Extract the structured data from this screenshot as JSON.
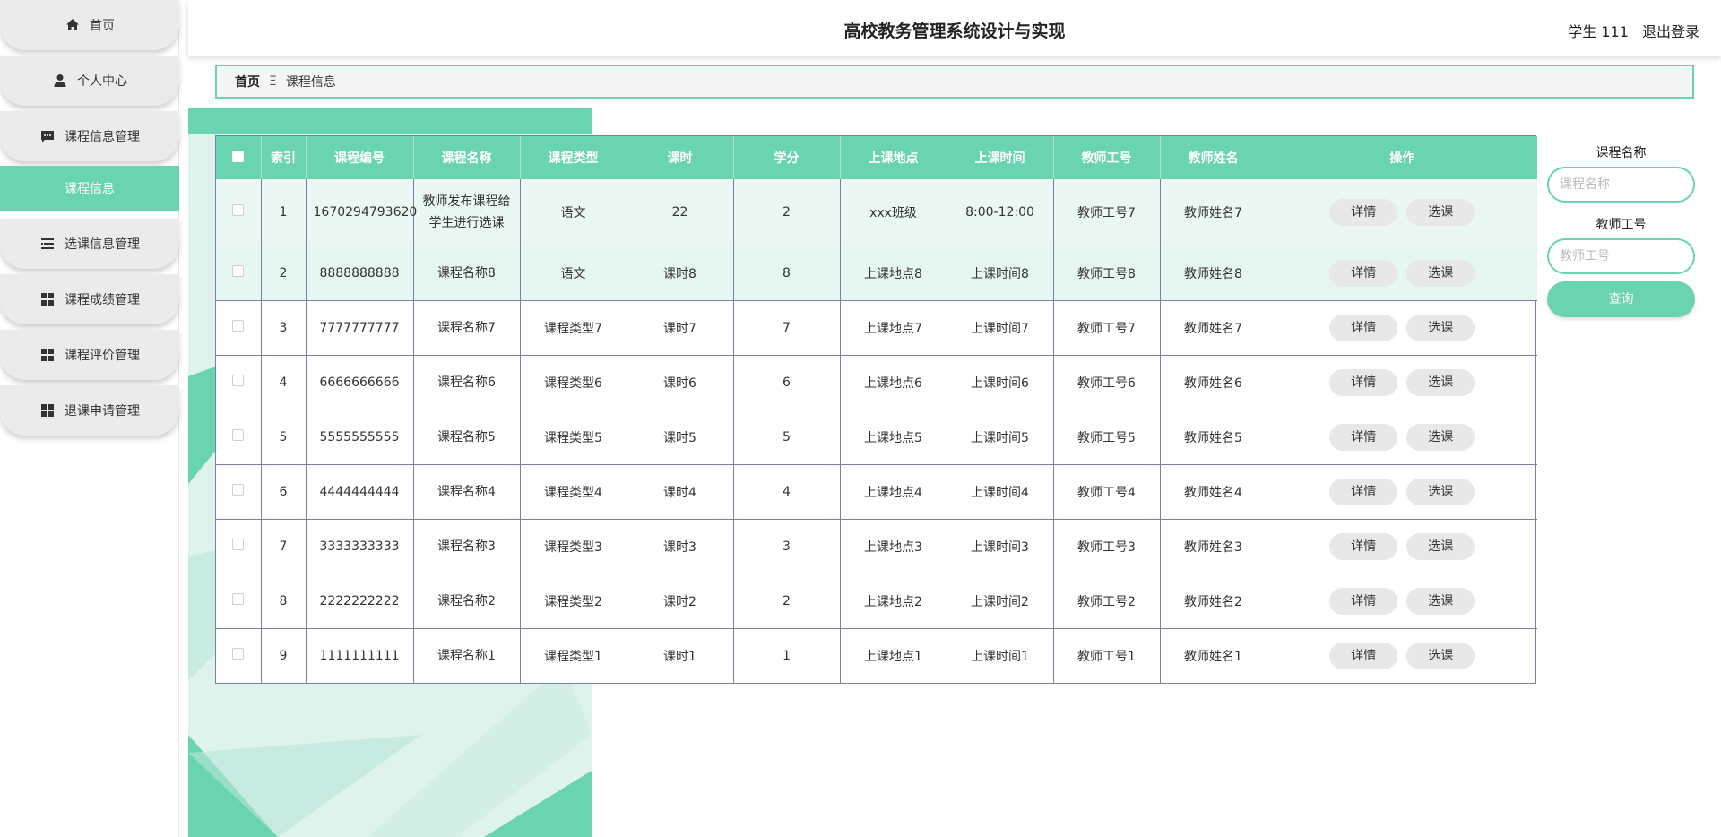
{
  "sidebar": {
    "items": [
      {
        "label": "首页",
        "icon": "home-icon"
      },
      {
        "label": "个人中心",
        "icon": "user-icon"
      },
      {
        "label": "课程信息管理",
        "icon": "chat-icon"
      },
      {
        "label": "课程信息",
        "icon": ""
      },
      {
        "label": "选课信息管理",
        "icon": "list-icon"
      },
      {
        "label": "课程成绩管理",
        "icon": "grid-icon"
      },
      {
        "label": "课程评价管理",
        "icon": "grid-icon"
      },
      {
        "label": "退课申请管理",
        "icon": "grid-icon"
      }
    ],
    "active_index": 3
  },
  "header": {
    "title": "高校教务管理系统设计与实现",
    "user": "学生 111",
    "logout": "退出登录"
  },
  "breadcrumb": {
    "home": "首页",
    "separator": "Ξ",
    "current": "课程信息"
  },
  "table": {
    "columns": [
      "索引",
      "课程编号",
      "课程名称",
      "课程类型",
      "课时",
      "学分",
      "上课地点",
      "上课时间",
      "教师工号",
      "教师姓名",
      "操作"
    ],
    "rows": [
      {
        "index": "1",
        "code": "1670294793620",
        "name": "教师发布课程给学生进行选课",
        "type": "语文",
        "hours": "22",
        "credit": "2",
        "place": "xxx班级",
        "time": "8:00-12:00",
        "tid": "教师工号7",
        "tname": "教师姓名7"
      },
      {
        "index": "2",
        "code": "8888888888",
        "name": "课程名称8",
        "type": "语文",
        "hours": "课时8",
        "credit": "8",
        "place": "上课地点8",
        "time": "上课时间8",
        "tid": "教师工号8",
        "tname": "教师姓名8"
      },
      {
        "index": "3",
        "code": "7777777777",
        "name": "课程名称7",
        "type": "课程类型7",
        "hours": "课时7",
        "credit": "7",
        "place": "上课地点7",
        "time": "上课时间7",
        "tid": "教师工号7",
        "tname": "教师姓名7"
      },
      {
        "index": "4",
        "code": "6666666666",
        "name": "课程名称6",
        "type": "课程类型6",
        "hours": "课时6",
        "credit": "6",
        "place": "上课地点6",
        "time": "上课时间6",
        "tid": "教师工号6",
        "tname": "教师姓名6"
      },
      {
        "index": "5",
        "code": "5555555555",
        "name": "课程名称5",
        "type": "课程类型5",
        "hours": "课时5",
        "credit": "5",
        "place": "上课地点5",
        "time": "上课时间5",
        "tid": "教师工号5",
        "tname": "教师姓名5"
      },
      {
        "index": "6",
        "code": "4444444444",
        "name": "课程名称4",
        "type": "课程类型4",
        "hours": "课时4",
        "credit": "4",
        "place": "上课地点4",
        "time": "上课时间4",
        "tid": "教师工号4",
        "tname": "教师姓名4"
      },
      {
        "index": "7",
        "code": "3333333333",
        "name": "课程名称3",
        "type": "课程类型3",
        "hours": "课时3",
        "credit": "3",
        "place": "上课地点3",
        "time": "上课时间3",
        "tid": "教师工号3",
        "tname": "教师姓名3"
      },
      {
        "index": "8",
        "code": "2222222222",
        "name": "课程名称2",
        "type": "课程类型2",
        "hours": "课时2",
        "credit": "2",
        "place": "上课地点2",
        "time": "上课时间2",
        "tid": "教师工号2",
        "tname": "教师姓名2"
      },
      {
        "index": "9",
        "code": "1111111111",
        "name": "课程名称1",
        "type": "课程类型1",
        "hours": "课时1",
        "credit": "1",
        "place": "上课地点1",
        "time": "上课时间1",
        "tid": "教师工号1",
        "tname": "教师姓名1"
      }
    ],
    "detail_label": "详情",
    "select_label": "选课"
  },
  "search": {
    "course_name_label": "课程名称",
    "course_name_placeholder": "课程名称",
    "teacher_id_label": "教师工号",
    "teacher_id_placeholder": "教师工号",
    "query_label": "查询"
  },
  "colors": {
    "accent": "#6ad3b0",
    "border": "#7a7fa0",
    "highlight_row": "#eaf7f3"
  }
}
